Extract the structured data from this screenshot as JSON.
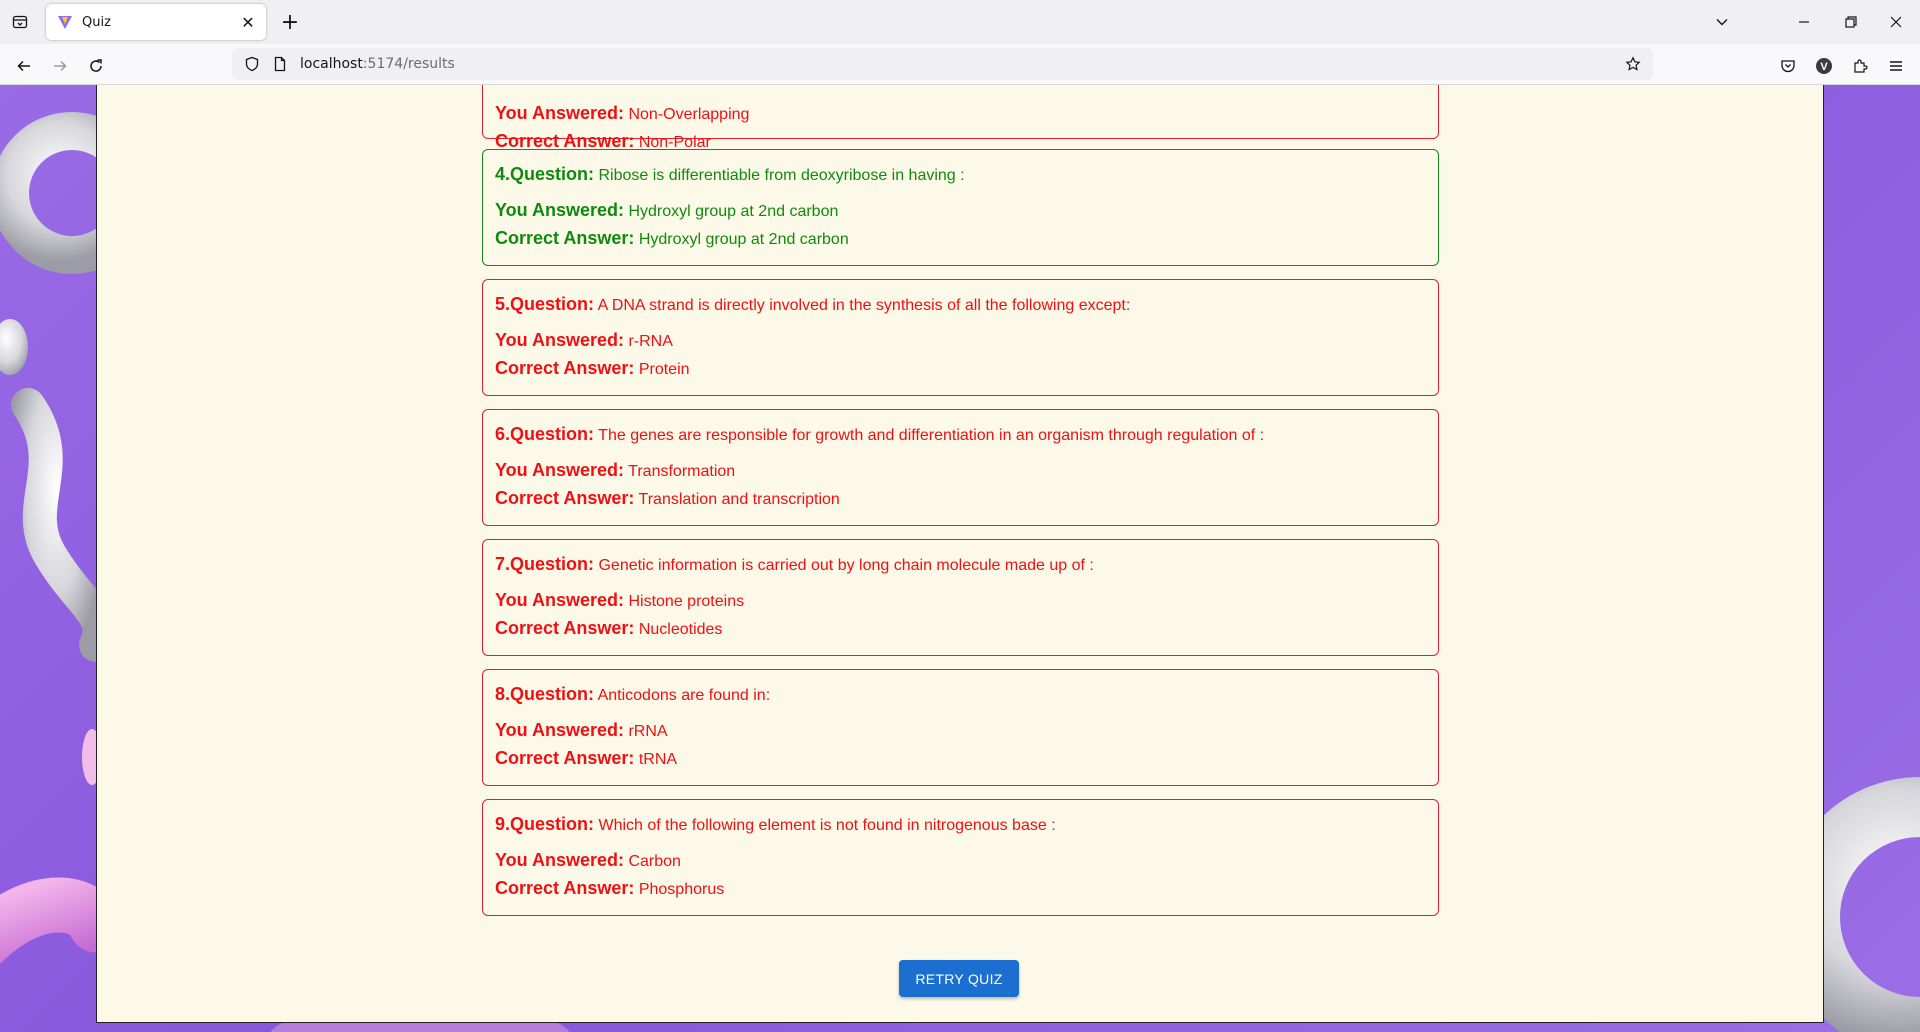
{
  "browser": {
    "tab_title": "Quiz",
    "url_host": "localhost",
    "url_rest": ":5174/results",
    "extension_badge": "V"
  },
  "questions": [
    {
      "number_label": "",
      "question": "",
      "answered_label": "You Answered:",
      "answered": "Non-Overlapping",
      "correct_label": "Correct Answer:",
      "correct": "Non-Polar",
      "is_correct": false
    },
    {
      "number_label": "4.Question:",
      "question": "Ribose is differentiable from deoxyribose in having :",
      "answered_label": "You Answered:",
      "answered": "Hydroxyl group at 2nd carbon",
      "correct_label": "Correct Answer:",
      "correct": "Hydroxyl group at 2nd carbon",
      "is_correct": true
    },
    {
      "number_label": "5.Question:",
      "question": "A DNA strand is directly involved in the synthesis of all the following except:",
      "answered_label": "You Answered:",
      "answered": "r-RNA",
      "correct_label": "Correct Answer:",
      "correct": "Protein",
      "is_correct": false
    },
    {
      "number_label": "6.Question:",
      "question": "The genes are responsible for growth and differentiation in an organism through regulation of :",
      "answered_label": "You Answered:",
      "answered": "Transformation",
      "correct_label": "Correct Answer:",
      "correct": "Translation and transcription",
      "is_correct": false
    },
    {
      "number_label": "7.Question:",
      "question": "Genetic information is carried out by long chain molecule made up of :",
      "answered_label": "You Answered:",
      "answered": "Histone proteins",
      "correct_label": "Correct Answer:",
      "correct": "Nucleotides",
      "is_correct": false
    },
    {
      "number_label": "8.Question:",
      "question": "Anticodons are found in:",
      "answered_label": "You Answered:",
      "answered": "rRNA",
      "correct_label": "Correct Answer:",
      "correct": "tRNA",
      "is_correct": false
    },
    {
      "number_label": "9.Question:",
      "question": "Which of the following element is not found in nitrogenous base :",
      "answered_label": "You Answered:",
      "answered": "Carbon",
      "correct_label": "Correct Answer:",
      "correct": "Phosphorus",
      "is_correct": false
    }
  ],
  "retry_label": "RETRY QUIZ",
  "colors": {
    "wrong": "#ee1014",
    "right": "#0f8a10",
    "button": "#1b6fd0",
    "card_bg": "#fdf9e8"
  }
}
